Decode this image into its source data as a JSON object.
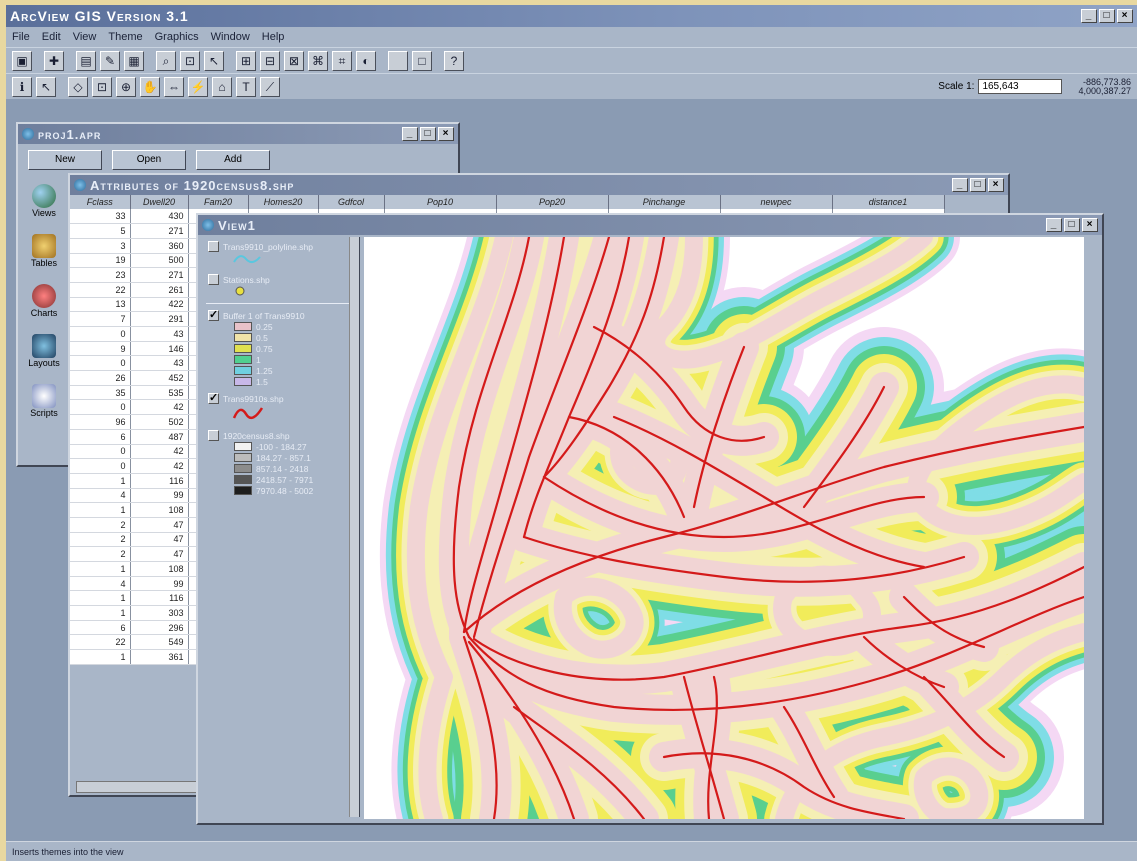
{
  "app": {
    "title": "ArcView GIS Version 3.1",
    "menu": [
      "File",
      "Edit",
      "View",
      "Theme",
      "Graphics",
      "Window",
      "Help"
    ],
    "scale_label": "Scale 1:",
    "scale_value": "165,643",
    "coords": [
      "-886,773.86",
      "4,000,387.27"
    ],
    "status_text": "Inserts themes into the view"
  },
  "project_window": {
    "title": "proj1.apr",
    "buttons": [
      "New",
      "Open",
      "Add"
    ],
    "doc_types": [
      "Views",
      "Tables",
      "Charts",
      "Layouts",
      "Scripts"
    ]
  },
  "attributes_window": {
    "title": "Attributes of 1920census8.shp",
    "columns": [
      "Fclass",
      "Dwell20",
      "Fam20",
      "Homes20",
      "Gdfcol",
      "Pop10",
      "Pop20",
      "Pinchange",
      "newpec",
      "distance1"
    ],
    "col1": [
      "33",
      "5",
      "3",
      "19",
      "23",
      "22",
      "13",
      "7",
      "0",
      "9",
      "0",
      "26",
      "35",
      "0",
      "96",
      "6",
      "0",
      "0",
      "1",
      "4",
      "1",
      "2",
      "2",
      "2",
      "1",
      "4",
      "1",
      "1",
      "6",
      "22",
      "1"
    ],
    "col2": [
      "430",
      "271",
      "360",
      "500",
      "271",
      "261",
      "422",
      "291",
      "43",
      "146",
      "43",
      "452",
      "535",
      "42",
      "502",
      "487",
      "42",
      "42",
      "116",
      "99",
      "108",
      "47",
      "47",
      "47",
      "108",
      "99",
      "116",
      "303",
      "296",
      "549",
      "361"
    ]
  },
  "view_window": {
    "title": "View1",
    "themes": [
      {
        "name": "Trans9910_polyline.shp",
        "checked": false,
        "symbol": "line-cyan"
      },
      {
        "name": "Stations.shp",
        "checked": false,
        "symbol": "point-yellow"
      },
      {
        "name": "Buffer 1 of Trans9910",
        "checked": true,
        "classes": [
          {
            "label": "0.25",
            "color": "#e8c2c9"
          },
          {
            "label": "0.5",
            "color": "#f0e3a8"
          },
          {
            "label": "0.75",
            "color": "#e0e050"
          },
          {
            "label": "1",
            "color": "#50d090"
          },
          {
            "label": "1.25",
            "color": "#70d0e0"
          },
          {
            "label": "1.5",
            "color": "#c8b8e8"
          }
        ]
      },
      {
        "name": "Trans9910s.shp",
        "checked": true,
        "symbol": "line-red"
      },
      {
        "name": "1920census8.shp",
        "checked": false,
        "classes": [
          {
            "label": "-100 - 184.27",
            "color": "#f2f2f2"
          },
          {
            "label": "184.27 - 857.1",
            "color": "#bcbcbc"
          },
          {
            "label": "857.14 - 2418",
            "color": "#8c8c8c"
          },
          {
            "label": "2418.57 - 7971",
            "color": "#555555"
          },
          {
            "label": "7970.48 - 5002",
            "color": "#1e1e1e"
          }
        ]
      }
    ],
    "map_colors": {
      "buffer_rings": [
        "#f4d8f4",
        "#7fdde6",
        "#59cf8f",
        "#f1ec5a",
        "#f5efb4",
        "#f1d4d4"
      ],
      "lines": "#d41a1a",
      "background": "#ffffff"
    }
  }
}
